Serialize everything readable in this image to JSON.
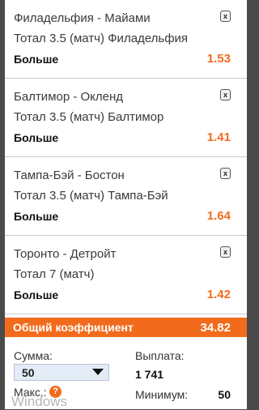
{
  "bets": [
    {
      "match": "Филадельфия - Майами",
      "market": "Тотал 3.5 (матч) Филадельфия",
      "outcome": "Больше",
      "odds": "1.53"
    },
    {
      "match": "Балтимор - Окленд",
      "market": "Тотал 3.5 (матч) Балтимор",
      "outcome": "Больше",
      "odds": "1.41"
    },
    {
      "match": "Тампа-Бэй - Бостон",
      "market": "Тотал 3.5 (матч) Тампа-Бэй",
      "outcome": "Больше",
      "odds": "1.64"
    },
    {
      "match": "Торонто - Детройт",
      "market": "Тотал 7 (матч)",
      "outcome": "Больше",
      "odds": "1.42"
    }
  ],
  "close_glyph": "x",
  "total": {
    "label": "Общий коэффициент",
    "value": "34.82"
  },
  "stake": {
    "label": "Сумма:",
    "selected": "50",
    "max_label": "Макс.:",
    "help_glyph": "?"
  },
  "payout": {
    "label": "Выплата:",
    "value": "1 741",
    "min_label": "Минимум:",
    "min_value": "50"
  },
  "watermark": "Windows",
  "colors": {
    "accent": "#f26b1d",
    "background": "#4a4a4a"
  }
}
